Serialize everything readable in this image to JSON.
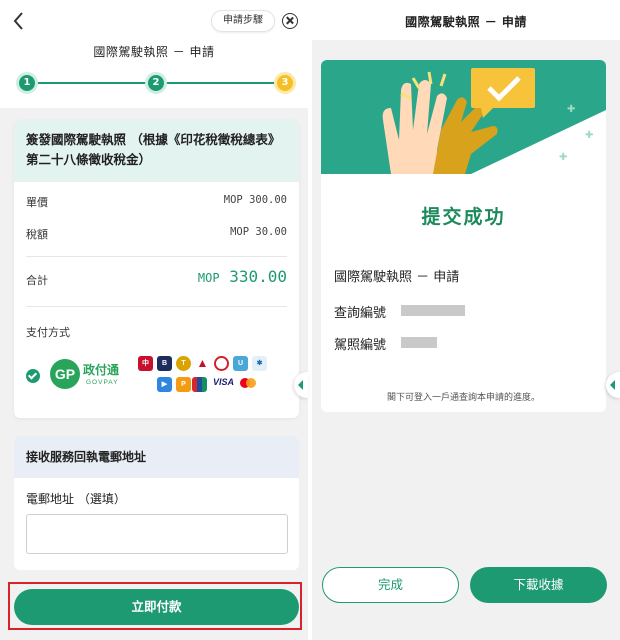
{
  "left": {
    "header": {
      "back_icon": "chevron-left-icon",
      "steps_button": "申請步驟",
      "close_icon": "close-circle-icon",
      "title": "國際駕駛執照 － 申請"
    },
    "stepper": {
      "steps": [
        "1",
        "2",
        "3"
      ],
      "current": 3
    },
    "payment_card": {
      "title": "簽發國際駕駛執照 （根據《印花稅徵稅總表》第二十八條徵收稅金）",
      "unit_price_label": "單價",
      "unit_price_value": "MOP 300.00",
      "tax_label": "稅額",
      "tax_value": "MOP 30.00",
      "total_label": "合計",
      "total_currency": "MOP",
      "total_amount": "330.00",
      "method_label": "支付方式",
      "govpay_mark": "GP",
      "govpay_name": "政付通",
      "govpay_en": "GOVPAY",
      "visa": "VISA"
    },
    "email_card": {
      "title": "接收服務回執電郵地址",
      "field_label": "電郵地址 （選填）",
      "field_value": ""
    },
    "pay_button": "立即付款"
  },
  "right": {
    "header": {
      "title": "國際駕駛執照 － 申請"
    },
    "success": {
      "title": "提交成功",
      "service": "國際駕駛執照 － 申請",
      "query_no_label": "查詢編號",
      "license_no_label": "駕照編號",
      "hint": "閣下可登入一戶通查詢本申請的進度。"
    },
    "buttons": {
      "done": "完成",
      "download_receipt": "下載收據"
    }
  },
  "colors": {
    "primary_green": "#1e9a72",
    "step_current": "#f6bf25",
    "highlight_red": "#d8232a",
    "banner_teal": "#2aa68a"
  }
}
